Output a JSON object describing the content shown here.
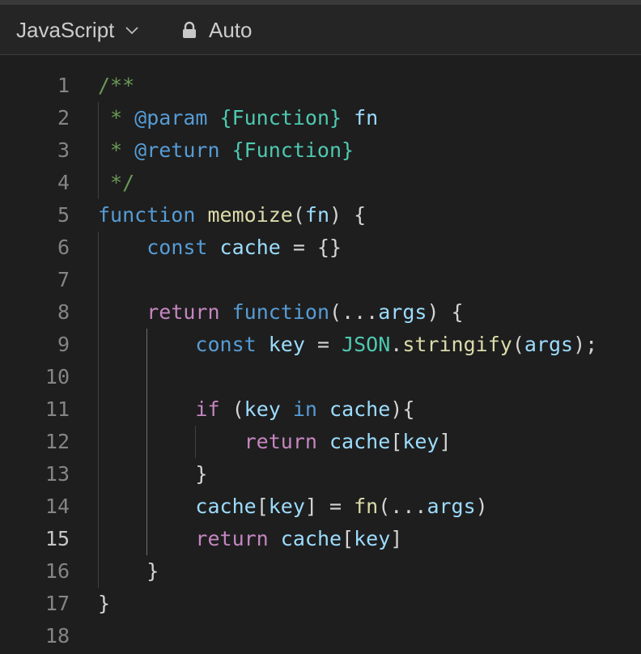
{
  "toolbar": {
    "language": "JavaScript",
    "language_icon": "chevron-down-icon",
    "mode_icon": "lock-icon",
    "mode": "Auto"
  },
  "colors": {
    "background": "#1e1e1e",
    "toolbar": "#252526",
    "comment": "#6a9955",
    "keyword": "#569cd6",
    "control": "#c586c0",
    "function": "#dcdcaa",
    "variable": "#9cdcfe",
    "type": "#4ec9b0"
  },
  "editor": {
    "active_line": 15,
    "lines": [
      {
        "number": "1",
        "tokens": [
          {
            "t": "/**",
            "c": "comment"
          }
        ]
      },
      {
        "number": "2",
        "tokens": [
          {
            "t": " * ",
            "c": "comment"
          },
          {
            "t": "@param",
            "c": "doctag"
          },
          {
            "t": " ",
            "c": "comment"
          },
          {
            "t": "{Function}",
            "c": "type"
          },
          {
            "t": " ",
            "c": "comment"
          },
          {
            "t": "fn",
            "c": "param"
          }
        ]
      },
      {
        "number": "3",
        "tokens": [
          {
            "t": " * ",
            "c": "comment"
          },
          {
            "t": "@return",
            "c": "doctag"
          },
          {
            "t": " ",
            "c": "comment"
          },
          {
            "t": "{Function}",
            "c": "type"
          }
        ]
      },
      {
        "number": "4",
        "tokens": [
          {
            "t": " */",
            "c": "comment"
          }
        ]
      },
      {
        "number": "5",
        "tokens": [
          {
            "t": "function",
            "c": "kw"
          },
          {
            "t": " ",
            "c": "punc"
          },
          {
            "t": "memoize",
            "c": "fn"
          },
          {
            "t": "(",
            "c": "punc"
          },
          {
            "t": "fn",
            "c": "var"
          },
          {
            "t": ") {",
            "c": "punc"
          }
        ]
      },
      {
        "number": "6",
        "tokens": [
          {
            "t": "    ",
            "c": "punc"
          },
          {
            "t": "const",
            "c": "kw"
          },
          {
            "t": " ",
            "c": "punc"
          },
          {
            "t": "cache",
            "c": "var"
          },
          {
            "t": " = {}",
            "c": "punc"
          }
        ]
      },
      {
        "number": "7",
        "tokens": []
      },
      {
        "number": "8",
        "tokens": [
          {
            "t": "    ",
            "c": "punc"
          },
          {
            "t": "return",
            "c": "ctrl"
          },
          {
            "t": " ",
            "c": "punc"
          },
          {
            "t": "function",
            "c": "kw"
          },
          {
            "t": "(...",
            "c": "punc"
          },
          {
            "t": "args",
            "c": "var"
          },
          {
            "t": ") {",
            "c": "punc"
          }
        ]
      },
      {
        "number": "9",
        "tokens": [
          {
            "t": "        ",
            "c": "punc"
          },
          {
            "t": "const",
            "c": "kw"
          },
          {
            "t": " ",
            "c": "punc"
          },
          {
            "t": "key",
            "c": "var"
          },
          {
            "t": " = ",
            "c": "punc"
          },
          {
            "t": "JSON",
            "c": "cls"
          },
          {
            "t": ".",
            "c": "punc"
          },
          {
            "t": "stringify",
            "c": "fn"
          },
          {
            "t": "(",
            "c": "punc"
          },
          {
            "t": "args",
            "c": "var"
          },
          {
            "t": ");",
            "c": "punc"
          }
        ]
      },
      {
        "number": "10",
        "tokens": []
      },
      {
        "number": "11",
        "tokens": [
          {
            "t": "        ",
            "c": "punc"
          },
          {
            "t": "if",
            "c": "ctrl"
          },
          {
            "t": " (",
            "c": "punc"
          },
          {
            "t": "key",
            "c": "var"
          },
          {
            "t": " ",
            "c": "punc"
          },
          {
            "t": "in",
            "c": "kw"
          },
          {
            "t": " ",
            "c": "punc"
          },
          {
            "t": "cache",
            "c": "var"
          },
          {
            "t": "){",
            "c": "punc"
          }
        ]
      },
      {
        "number": "12",
        "tokens": [
          {
            "t": "            ",
            "c": "punc"
          },
          {
            "t": "return",
            "c": "ctrl"
          },
          {
            "t": " ",
            "c": "punc"
          },
          {
            "t": "cache",
            "c": "var"
          },
          {
            "t": "[",
            "c": "punc"
          },
          {
            "t": "key",
            "c": "var"
          },
          {
            "t": "]",
            "c": "punc"
          }
        ]
      },
      {
        "number": "13",
        "tokens": [
          {
            "t": "        }",
            "c": "punc"
          }
        ]
      },
      {
        "number": "14",
        "tokens": [
          {
            "t": "        ",
            "c": "punc"
          },
          {
            "t": "cache",
            "c": "var"
          },
          {
            "t": "[",
            "c": "punc"
          },
          {
            "t": "key",
            "c": "var"
          },
          {
            "t": "] = ",
            "c": "punc"
          },
          {
            "t": "fn",
            "c": "fn"
          },
          {
            "t": "(...",
            "c": "punc"
          },
          {
            "t": "args",
            "c": "var"
          },
          {
            "t": ")",
            "c": "punc"
          }
        ]
      },
      {
        "number": "15",
        "tokens": [
          {
            "t": "        ",
            "c": "punc"
          },
          {
            "t": "return",
            "c": "ctrl"
          },
          {
            "t": " ",
            "c": "punc"
          },
          {
            "t": "cache",
            "c": "var"
          },
          {
            "t": "[",
            "c": "punc"
          },
          {
            "t": "key",
            "c": "var"
          },
          {
            "t": "]",
            "c": "punc"
          }
        ]
      },
      {
        "number": "16",
        "tokens": [
          {
            "t": "    }",
            "c": "punc"
          }
        ]
      },
      {
        "number": "17",
        "tokens": [
          {
            "t": "}",
            "c": "punc"
          }
        ]
      },
      {
        "number": "18",
        "tokens": []
      }
    ]
  }
}
